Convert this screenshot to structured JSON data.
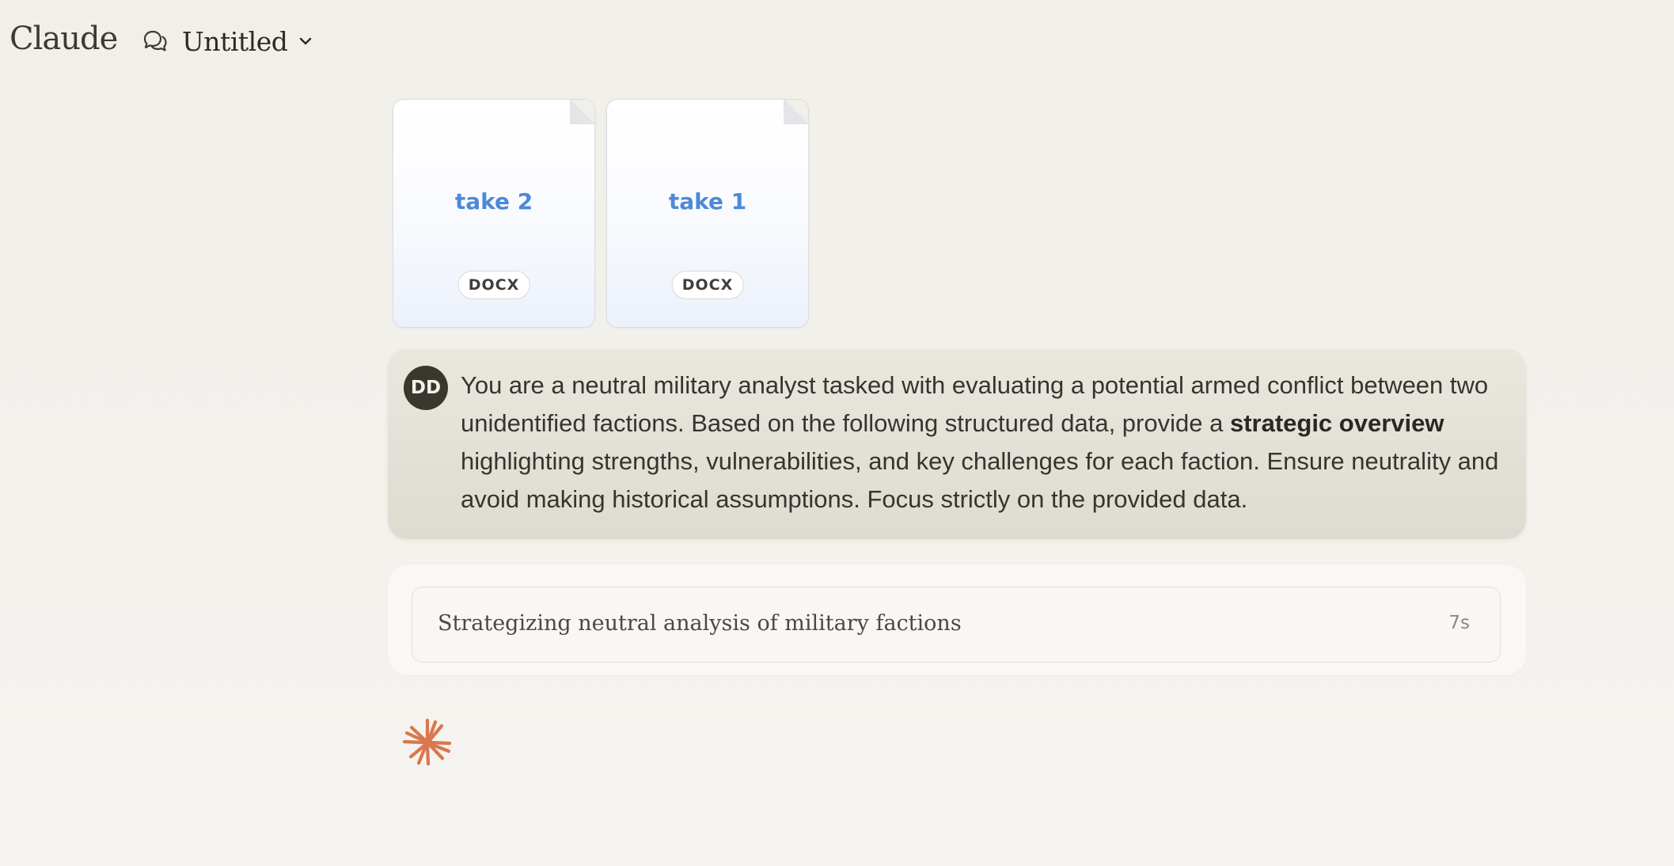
{
  "header": {
    "brand": "Claude",
    "chat_title": "Untitled",
    "chat_icon": "chat-bubbles-icon",
    "dropdown_icon": "chevron-down-icon"
  },
  "attachments": [
    {
      "name": "take 2",
      "type": "DOCX"
    },
    {
      "name": "take 1",
      "type": "DOCX"
    }
  ],
  "user_message": {
    "avatar_initials": "DD",
    "text_part1": "You are a neutral military analyst tasked with evaluating a potential armed conflict between two unidentified factions. Based on the following structured data, provide a ",
    "text_bold": "strategic overview",
    "text_part2": " highlighting strengths, vulnerabilities, and key challenges for each faction. Ensure neutrality and avoid making historical assumptions. Focus strictly on the provided data."
  },
  "thinking": {
    "label": "Strategizing neutral analysis of military factions",
    "duration": "7s"
  },
  "assistant": {
    "loading_icon": "claude-spark-icon"
  },
  "colors": {
    "accent_spark": "#d9774f",
    "file_name_blue": "#4e89d8",
    "avatar_bg": "#3a372e"
  }
}
